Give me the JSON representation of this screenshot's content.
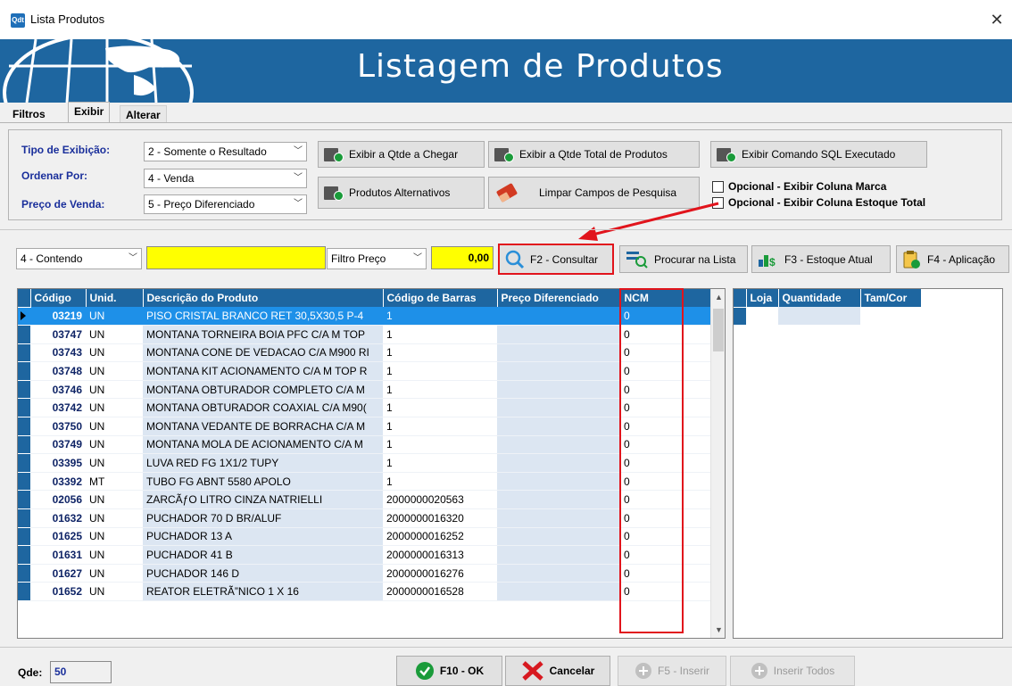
{
  "window": {
    "title": "Lista Produtos",
    "close_glyph": "✕",
    "app_icon_text": "Qdt"
  },
  "banner": {
    "title": "Listagem de Produtos"
  },
  "tabs": [
    {
      "label": "Filtros"
    },
    {
      "label": "Exibir"
    },
    {
      "label": "Alterar"
    }
  ],
  "options": {
    "tipo_label": "Tipo de Exibição:",
    "tipo_value": "2 - Somente o Resultado",
    "ordenar_label": "Ordenar Por:",
    "ordenar_value": "4 - Venda",
    "preco_label": "Preço de Venda:",
    "preco_value": "5 - Preço Diferenciado",
    "btn_qtde_chegar": "Exibir a Qtde a Chegar",
    "btn_qtde_total": "Exibir a Qtde Total de Produtos",
    "btn_sql": "Exibir Comando SQL Executado",
    "btn_alternativos": "Produtos Alternativos",
    "btn_limpar": "Limpar Campos de Pesquisa",
    "chk_marca": "Opcional - Exibir Coluna Marca",
    "chk_estoque": "Opcional - Exibir Coluna Estoque Total"
  },
  "toolbar": {
    "match_value": "4 - Contendo",
    "search_value": "",
    "filtro_value": "Filtro Preço",
    "price_value": "0,00",
    "btn_consultar": "F2 - Consultar",
    "btn_procurar": "Procurar na Lista",
    "btn_estoque": "F3 - Estoque Atual",
    "btn_aplicacao": "F4 - Aplicação"
  },
  "grid": {
    "columns": [
      "Código",
      "Unid.",
      "Descrição do Produto",
      "Código de Barras",
      "Preço Diferenciado",
      "NCM"
    ],
    "rows": [
      {
        "codigo": "03219",
        "unid": "UN",
        "desc": "PISO CRISTAL BRANCO RET 30,5X30,5 P-4",
        "barras": "1",
        "preco": "",
        "ncm": "0"
      },
      {
        "codigo": "03747",
        "unid": "UN",
        "desc": "MONTANA TORNEIRA BOIA PFC C/A M TOP",
        "barras": "1",
        "preco": "",
        "ncm": "0"
      },
      {
        "codigo": "03743",
        "unid": "UN",
        "desc": "MONTANA CONE DE VEDACAO C/A M900 RI",
        "barras": "1",
        "preco": "",
        "ncm": "0"
      },
      {
        "codigo": "03748",
        "unid": "UN",
        "desc": "MONTANA KIT ACIONAMENTO C/A M TOP R",
        "barras": "1",
        "preco": "",
        "ncm": "0"
      },
      {
        "codigo": "03746",
        "unid": "UN",
        "desc": "MONTANA OBTURADOR COMPLETO C/A M",
        "barras": "1",
        "preco": "",
        "ncm": "0"
      },
      {
        "codigo": "03742",
        "unid": "UN",
        "desc": "MONTANA OBTURADOR COAXIAL C/A M90(",
        "barras": "1",
        "preco": "",
        "ncm": "0"
      },
      {
        "codigo": "03750",
        "unid": "UN",
        "desc": "MONTANA VEDANTE DE BORRACHA C/A M",
        "barras": "1",
        "preco": "",
        "ncm": "0"
      },
      {
        "codigo": "03749",
        "unid": "UN",
        "desc": "MONTANA MOLA DE ACIONAMENTO C/A M",
        "barras": "1",
        "preco": "",
        "ncm": "0"
      },
      {
        "codigo": "03395",
        "unid": "UN",
        "desc": "LUVA RED FG 1X1/2 TUPY",
        "barras": "1",
        "preco": "",
        "ncm": "0"
      },
      {
        "codigo": "03392",
        "unid": "MT",
        "desc": "TUBO FG ABNT 5580 APOLO",
        "barras": "1",
        "preco": "",
        "ncm": "0"
      },
      {
        "codigo": "02056",
        "unid": "UN",
        "desc": "ZARCÃƒO LITRO CINZA NATRIELLI",
        "barras": "2000000020563",
        "preco": "",
        "ncm": "0"
      },
      {
        "codigo": "01632",
        "unid": "UN",
        "desc": "PUCHADOR 70 D BR/ALUF",
        "barras": "2000000016320",
        "preco": "",
        "ncm": "0"
      },
      {
        "codigo": "01625",
        "unid": "UN",
        "desc": "PUCHADOR 13 A",
        "barras": "2000000016252",
        "preco": "",
        "ncm": "0"
      },
      {
        "codigo": "01631",
        "unid": "UN",
        "desc": "PUCHADOR 41 B",
        "barras": "2000000016313",
        "preco": "",
        "ncm": "0"
      },
      {
        "codigo": "01627",
        "unid": "UN",
        "desc": "PUCHADOR 146 D",
        "barras": "2000000016276",
        "preco": "",
        "ncm": "0"
      },
      {
        "codigo": "01652",
        "unid": "UN",
        "desc": "REATOR ELETRÃ”NICO 1 X 16",
        "barras": "2000000016528",
        "preco": "",
        "ncm": "0"
      }
    ]
  },
  "side_grid": {
    "columns": [
      "Loja",
      "Quantidade",
      "Tam/Cor"
    ]
  },
  "footer": {
    "qde_label": "Qde:",
    "qde_value": "50",
    "btn_ok": "F10 - OK",
    "btn_cancelar": "Cancelar",
    "btn_inserir": "F5 - Inserir",
    "btn_inserir_todos": "Inserir Todos"
  },
  "colors": {
    "accent": "#1e66a0",
    "selection": "#1e90e8",
    "highlight": "#e1141c",
    "field": "#ffff00"
  }
}
